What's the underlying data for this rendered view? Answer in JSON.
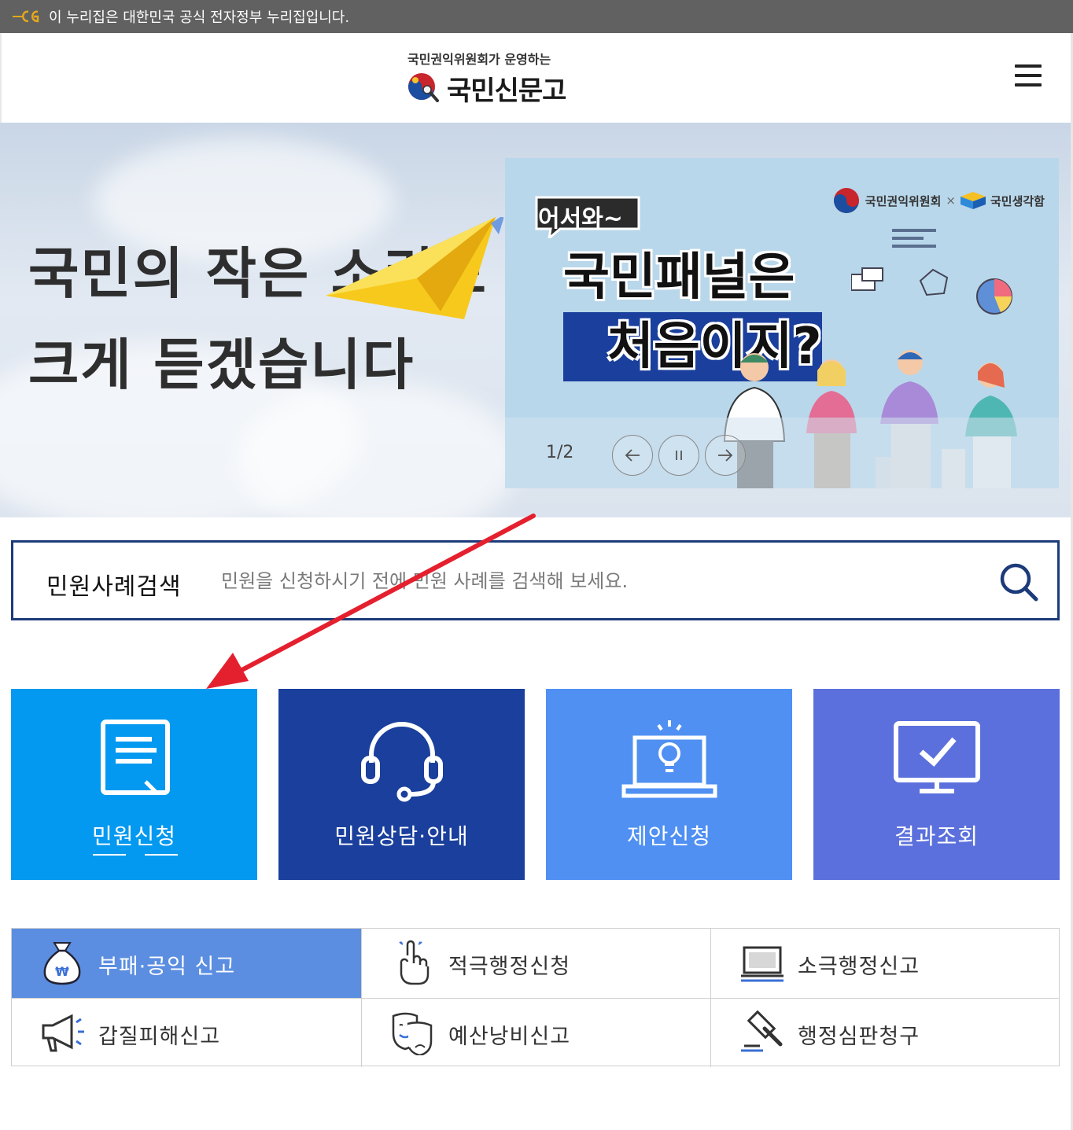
{
  "gov_banner": {
    "text": "이 누리집은 대한민국 공식 전자정부 누리집입니다.",
    "logo_icon": "egov-logo-icon"
  },
  "header": {
    "brand_subtitle": "국민권익위원회가 운영하는",
    "brand_name": "국민신문고",
    "menu_icon": "hamburger-menu-icon"
  },
  "hero": {
    "line1": "국민의 작은 소리도",
    "line2": "크게 듣겠습니다"
  },
  "slider": {
    "org1": "국민권익위원회",
    "separator": "×",
    "org2": "국민생각함",
    "bubble": "어서와~",
    "title_line1": "국민패널은",
    "title_line2": "처음이지?",
    "pager": "1/2"
  },
  "search": {
    "label": "민원사례검색",
    "placeholder": "민원을 신청하시기 전에 민원 사례를 검색해 보세요."
  },
  "tiles": [
    {
      "label": "민원신청",
      "icon": "document-icon",
      "color": "#0399f0"
    },
    {
      "label": "민원상담·안내",
      "icon": "headset-icon",
      "color": "#1a3f9c"
    },
    {
      "label": "제안신청",
      "icon": "laptop-lightbulb-icon",
      "color": "#4f90f2"
    },
    {
      "label": "결과조회",
      "icon": "monitor-check-icon",
      "color": "#5b70dc"
    }
  ],
  "reports": [
    {
      "label": "부패·공익 신고",
      "icon": "money-bag-icon"
    },
    {
      "label": "적극행정신청",
      "icon": "pointing-hand-icon"
    },
    {
      "label": "소극행정신고",
      "icon": "laptop-icon"
    },
    {
      "label": "갑질피해신고",
      "icon": "megaphone-icon"
    },
    {
      "label": "예산낭비신고",
      "icon": "theater-masks-icon"
    },
    {
      "label": "행정심판청구",
      "icon": "gavel-icon"
    }
  ],
  "colors": {
    "gov_bar": "#616161",
    "search_border": "#1d3b7a",
    "active_report": "#5b8ee0",
    "annotation_arrow": "#e5202e"
  }
}
